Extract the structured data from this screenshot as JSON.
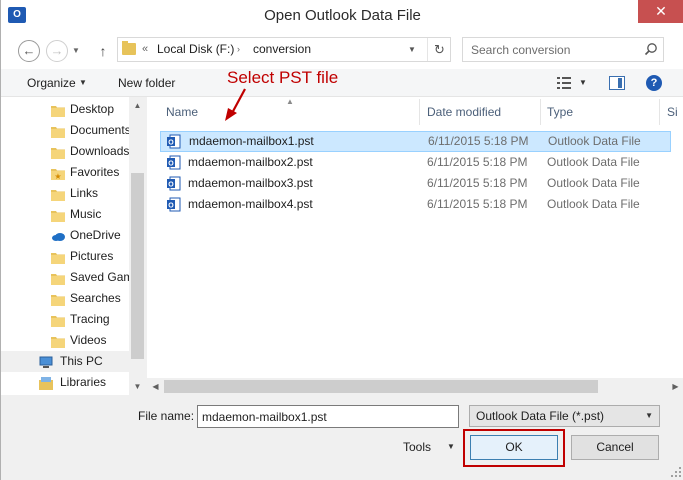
{
  "window": {
    "title": "Open Outlook Data File",
    "app_icon_text": "O",
    "close_glyph": "✕"
  },
  "address_bar": {
    "overflow_glyph": "«",
    "crumbs": [
      "Local Disk (F:)",
      "conversion"
    ],
    "separator_glyph": "›",
    "refresh_glyph": "↻",
    "back_glyph": "←",
    "forward_glyph": "→",
    "up_glyph": "↑"
  },
  "search": {
    "placeholder": "Search conversion"
  },
  "toolbar": {
    "organize_label": "Organize",
    "new_folder_label": "New folder",
    "help_glyph": "?"
  },
  "nav": {
    "items": [
      {
        "label": "Desktop",
        "icon": "folder-icon"
      },
      {
        "label": "Documents",
        "icon": "folder-icon"
      },
      {
        "label": "Downloads",
        "icon": "folder-icon"
      },
      {
        "label": "Favorites",
        "icon": "folder-star-icon"
      },
      {
        "label": "Links",
        "icon": "folder-icon"
      },
      {
        "label": "Music",
        "icon": "folder-icon"
      },
      {
        "label": "OneDrive",
        "icon": "onedrive-icon"
      },
      {
        "label": "Pictures",
        "icon": "folder-icon"
      },
      {
        "label": "Saved Gam",
        "icon": "folder-icon"
      },
      {
        "label": "Searches",
        "icon": "folder-icon"
      },
      {
        "label": "Tracing",
        "icon": "folder-icon"
      },
      {
        "label": "Videos",
        "icon": "folder-icon"
      },
      {
        "label": "This PC",
        "icon": "computer-icon"
      },
      {
        "label": "Libraries",
        "icon": "libraries-icon"
      }
    ]
  },
  "file_list": {
    "columns": [
      "Name",
      "Date modified",
      "Type",
      "Si"
    ],
    "rows": [
      {
        "name": "mdaemon-mailbox1.pst",
        "date": "6/11/2015 5:18 PM",
        "type": "Outlook Data File"
      },
      {
        "name": "mdaemon-mailbox2.pst",
        "date": "6/11/2015 5:18 PM",
        "type": "Outlook Data File"
      },
      {
        "name": "mdaemon-mailbox3.pst",
        "date": "6/11/2015 5:18 PM",
        "type": "Outlook Data File"
      },
      {
        "name": "mdaemon-mailbox4.pst",
        "date": "6/11/2015 5:18 PM",
        "type": "Outlook Data File"
      }
    ],
    "selected_index": 0,
    "annotation": "Select PST file"
  },
  "footer": {
    "file_name_label": "File name:",
    "file_name_value": "mdaemon-mailbox1.pst",
    "file_type_value": "Outlook Data File (*.pst)",
    "tools_label": "Tools",
    "ok_label": "OK",
    "cancel_label": "Cancel"
  },
  "colors": {
    "accent": "#1f5ab3",
    "selection": "#cce8ff",
    "annotation": "#c00000"
  }
}
